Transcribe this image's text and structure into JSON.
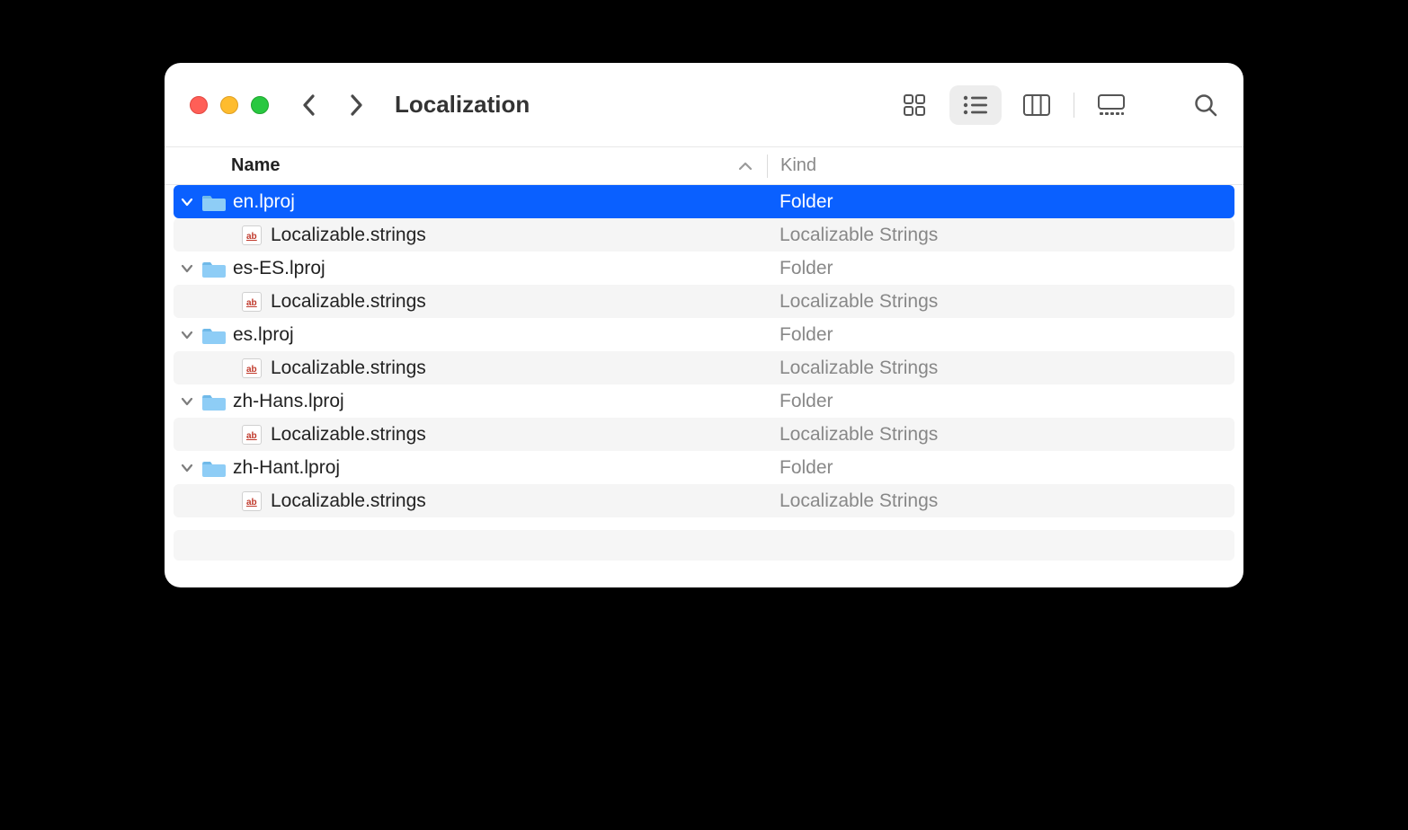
{
  "window": {
    "title": "Localization"
  },
  "columns": {
    "name": "Name",
    "kind": "Kind",
    "sort_asc": true
  },
  "rows": [
    {
      "level": 0,
      "expanded": true,
      "selected": true,
      "icon": "folder",
      "name": "en.lproj",
      "kind": "Folder"
    },
    {
      "level": 1,
      "expanded": null,
      "selected": false,
      "icon": "strings",
      "name": "Localizable.strings",
      "kind": "Localizable Strings"
    },
    {
      "level": 0,
      "expanded": true,
      "selected": false,
      "icon": "folder",
      "name": "es-ES.lproj",
      "kind": "Folder"
    },
    {
      "level": 1,
      "expanded": null,
      "selected": false,
      "icon": "strings",
      "name": "Localizable.strings",
      "kind": "Localizable Strings"
    },
    {
      "level": 0,
      "expanded": true,
      "selected": false,
      "icon": "folder",
      "name": "es.lproj",
      "kind": "Folder"
    },
    {
      "level": 1,
      "expanded": null,
      "selected": false,
      "icon": "strings",
      "name": "Localizable.strings",
      "kind": "Localizable Strings"
    },
    {
      "level": 0,
      "expanded": true,
      "selected": false,
      "icon": "folder",
      "name": "zh-Hans.lproj",
      "kind": "Folder"
    },
    {
      "level": 1,
      "expanded": null,
      "selected": false,
      "icon": "strings",
      "name": "Localizable.strings",
      "kind": "Localizable Strings"
    },
    {
      "level": 0,
      "expanded": true,
      "selected": false,
      "icon": "folder",
      "name": "zh-Hant.lproj",
      "kind": "Folder"
    },
    {
      "level": 1,
      "expanded": null,
      "selected": false,
      "icon": "strings",
      "name": "Localizable.strings",
      "kind": "Localizable Strings"
    }
  ],
  "view_modes": {
    "active": "list"
  },
  "colors": {
    "selection": "#0a60ff",
    "folder_fill": "#8ecdf6",
    "folder_tab": "#6fb9e8"
  }
}
